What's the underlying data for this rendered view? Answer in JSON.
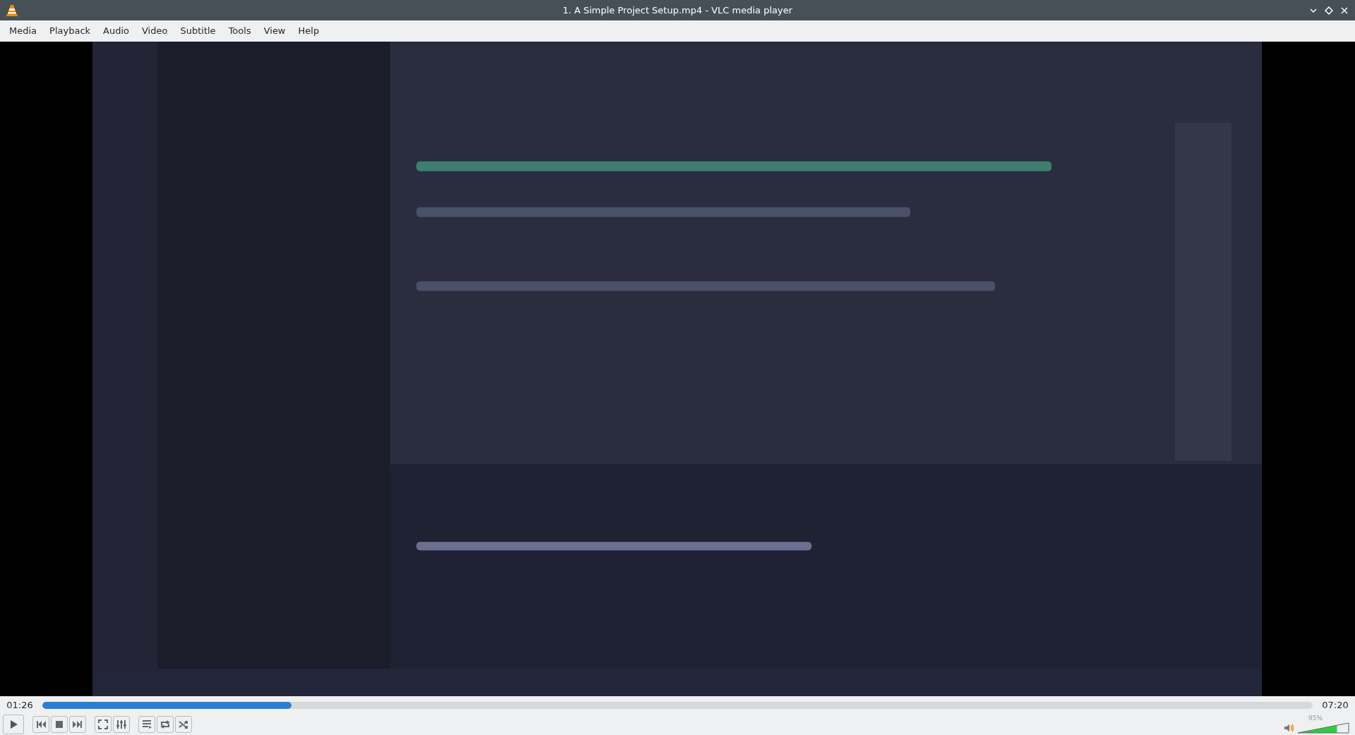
{
  "window": {
    "title": "1. A Simple Project Setup.mp4 - VLC media player"
  },
  "menu": [
    "Media",
    "Playback",
    "Audio",
    "Video",
    "Subtitle",
    "Tools",
    "View",
    "Help"
  ],
  "seek": {
    "elapsed": "01:26",
    "total": "07:20",
    "level": 0.196
  },
  "controls": [
    {
      "kind": "play"
    },
    {
      "kind": "gap"
    },
    {
      "kind": "prev"
    },
    {
      "kind": "stop"
    },
    {
      "kind": "next"
    },
    {
      "kind": "gap"
    },
    {
      "kind": "fullscreen"
    },
    {
      "kind": "extended"
    },
    {
      "kind": "gap"
    },
    {
      "kind": "playlist"
    },
    {
      "kind": "loop"
    },
    {
      "kind": "shuffle"
    }
  ],
  "volume": {
    "reading": "95%",
    "level": 0.77
  }
}
